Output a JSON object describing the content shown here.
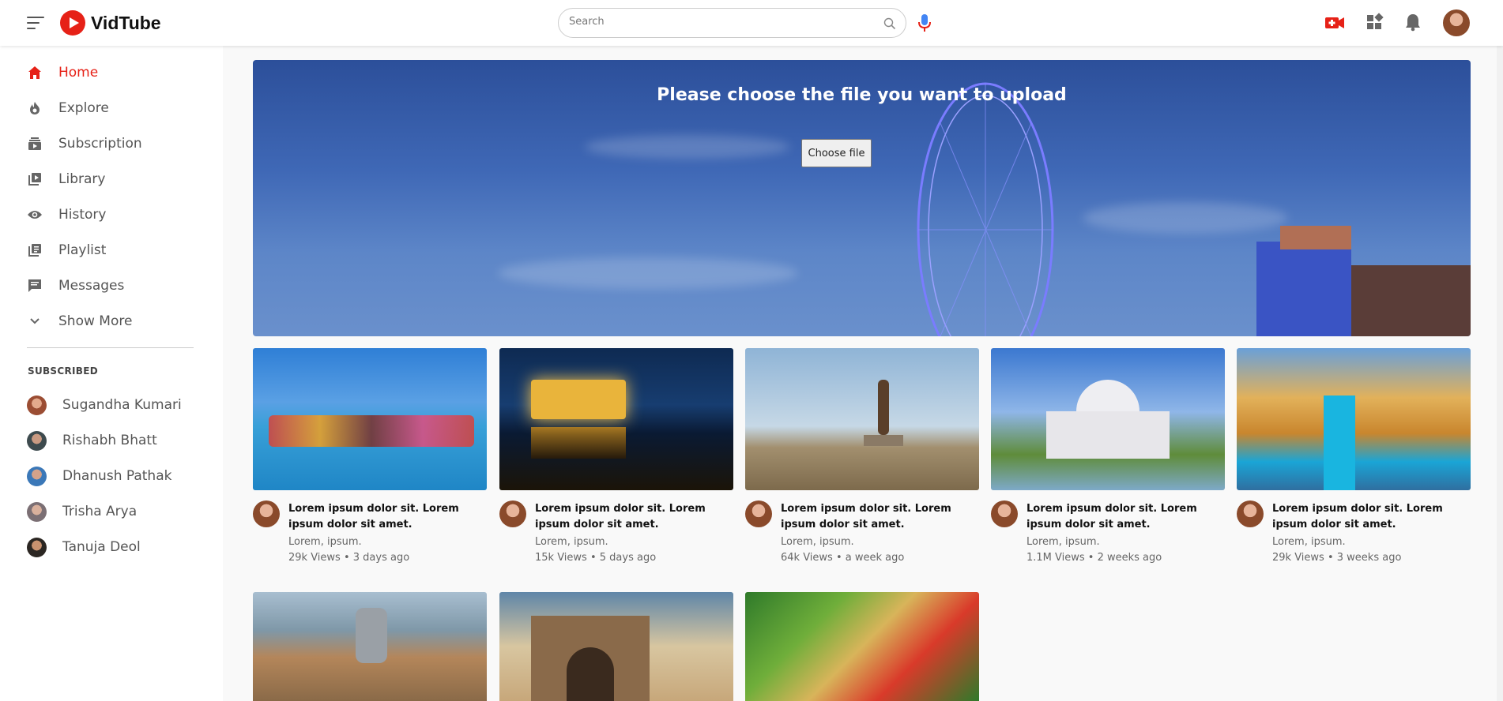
{
  "app": {
    "name": "VidTube"
  },
  "search": {
    "placeholder": "Search"
  },
  "header_icons": [
    "menu-icon",
    "mic-icon",
    "video-camera-icon",
    "apps-grid-icon",
    "bell-icon",
    "avatar"
  ],
  "sidebar": {
    "items": [
      {
        "label": "Home",
        "icon": "home-icon",
        "active": true
      },
      {
        "label": "Explore",
        "icon": "fire-icon"
      },
      {
        "label": "Subscription",
        "icon": "subscription-icon"
      },
      {
        "label": "Library",
        "icon": "library-icon"
      },
      {
        "label": "History",
        "icon": "eye-icon"
      },
      {
        "label": "Playlist",
        "icon": "playlist-icon"
      },
      {
        "label": "Messages",
        "icon": "message-icon"
      },
      {
        "label": "Show More",
        "icon": "chevron-down-icon"
      }
    ],
    "subscribed_heading": "SUBSCRIBED",
    "subscribed": [
      {
        "name": "Sugandha Kumari"
      },
      {
        "name": "Rishabh Bhatt"
      },
      {
        "name": "Dhanush Pathak"
      },
      {
        "name": "Trisha Arya"
      },
      {
        "name": "Tanuja Deol"
      }
    ]
  },
  "banner": {
    "heading": "Please choose the file you want to upload",
    "button_label": "Choose file"
  },
  "videos": [
    {
      "title": "Lorem ipsum dolor sit. Lorem ipsum dolor sit amet.",
      "channel": "Lorem, ipsum.",
      "meta": "29k Views • 3 days ago"
    },
    {
      "title": "Lorem ipsum dolor sit. Lorem ipsum dolor sit amet.",
      "channel": "Lorem, ipsum.",
      "meta": "15k Views • 5 days ago"
    },
    {
      "title": "Lorem ipsum dolor sit. Lorem ipsum dolor sit amet.",
      "channel": "Lorem, ipsum.",
      "meta": "64k Views • a week ago"
    },
    {
      "title": "Lorem ipsum dolor sit. Lorem ipsum dolor sit amet.",
      "channel": "Lorem, ipsum.",
      "meta": "1.1M Views • 2 weeks ago"
    },
    {
      "title": "Lorem ipsum dolor sit. Lorem ipsum dolor sit amet.",
      "channel": "Lorem, ipsum.",
      "meta": "29k Views • 3 weeks ago"
    }
  ],
  "colors": {
    "accent": "#e62117",
    "mic_blue": "#4285f4"
  }
}
